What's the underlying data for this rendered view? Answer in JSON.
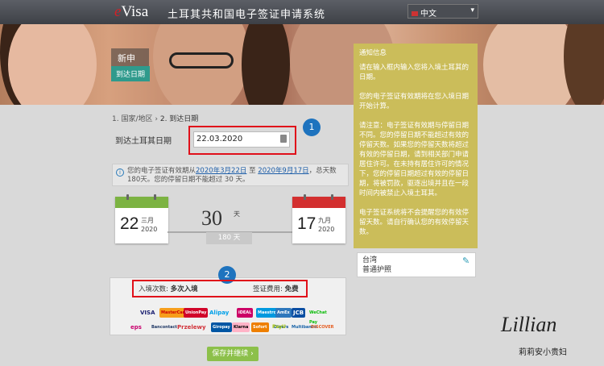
{
  "header": {
    "logo_prefix": "e",
    "logo_text": "Visa",
    "title": "土耳其共和国电子签证申请系统",
    "language": "中文"
  },
  "banner": {
    "label_new": "新申请",
    "label_step": "到达日期"
  },
  "notice": {
    "heading": "通知信息",
    "p1": "请在输入框内输入您将入境土耳其的日期。",
    "p2": "您的电子签证有效期将在您入境日期开始计算。",
    "p3": "请注意：电子签证有效期与停留日期不同。您的停留日期不能超过有效的停留天数。如果您的停留天数将超过有效的停留日期，请到相关部门申请居住许可。在未持有居住许可的情况下，您的停留日期超过有效的停留日期，将被罚款，驱逐出境并且在一段时间内被禁止入境土耳其。",
    "p4": "电子签证系统将不会提醒您的有效停留天数。请自行确认您的有效停留天数。"
  },
  "breadcrumb": {
    "step1": "1. 国家/地区",
    "sep": "›",
    "step2": "2. 到达日期"
  },
  "form": {
    "date_label": "到达土耳其日期",
    "date_value": "22.03.2020"
  },
  "annotations": {
    "badge1": "1",
    "badge2": "2"
  },
  "info": {
    "text_a": "您的电子签证有效期从",
    "date_from": "2020年3月22日",
    "text_b": " 至 ",
    "date_to": "2020年9月17日",
    "text_c": "，总天数 180天。您的停留日期不能超过 30 天。"
  },
  "calendar_start": {
    "day": "22",
    "month": "三月",
    "year": "2020"
  },
  "calendar_end": {
    "day": "17",
    "month": "九月",
    "year": "2020"
  },
  "duration": {
    "stay_days": "30",
    "stay_unit": "天",
    "total_days": "180 天"
  },
  "passport": {
    "country": "台湾",
    "type": "普通护照"
  },
  "fees": {
    "entry_label": "入境次数:",
    "entry_value": "多次入境",
    "fee_label": "签证费用:",
    "fee_value": "免费"
  },
  "payment_logos": [
    "VISA",
    "MasterCard",
    "UnionPay",
    "Alipay",
    "iDEAL",
    "Maestro",
    "AmEx",
    "JCB",
    "WeChat Pay",
    "eps",
    "Bancontact",
    "Przelewy",
    "Giropay",
    "Klarna",
    "Sofort",
    "Diners",
    "PayU",
    "Multibanco",
    "DISCOVER"
  ],
  "actions": {
    "continue": "保存并继续"
  },
  "watermark": {
    "name": "Lillian",
    "subtitle": "莉莉安小贵妇"
  }
}
